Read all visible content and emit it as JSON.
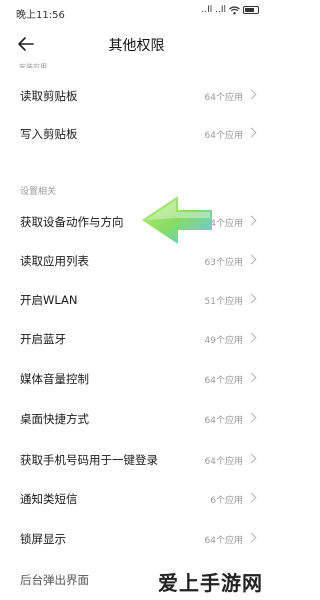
{
  "status_bar": {
    "time": "晚上11:56",
    "network": "..Il ..Il",
    "wifi_icon": "wifi-icon",
    "battery": "battery"
  },
  "header": {
    "title": "其他权限",
    "back_icon": "arrow-left-icon"
  },
  "cut_label": "安装应用",
  "rows_top": [
    {
      "label": "读取剪贴板",
      "count": "64个应用"
    },
    {
      "label": "写入剪贴板",
      "count": "64个应用"
    }
  ],
  "section": {
    "label": "设置相关"
  },
  "rows_settings": [
    {
      "label": "获取设备动作与方向",
      "count": "4个应用"
    },
    {
      "label": "读取应用列表",
      "count": "63个应用"
    },
    {
      "label": "开启WLAN",
      "count": "51个应用"
    },
    {
      "label": "开启蓝牙",
      "count": "49个应用"
    },
    {
      "label": "媒体音量控制",
      "count": "64个应用"
    },
    {
      "label": "桌面快捷方式",
      "count": "64个应用"
    },
    {
      "label": "获取手机号码用于一键登录",
      "count": "64个应用"
    },
    {
      "label": "通知类短信",
      "count": "6个应用"
    },
    {
      "label": "锁屏显示",
      "count": "64个应用"
    }
  ],
  "bottom_row": {
    "label": "后台弹出界面"
  },
  "watermark": "爱上手游网",
  "colors": {
    "arrow_green": "#9be34a",
    "arrow_blue": "#4fc3f7"
  }
}
